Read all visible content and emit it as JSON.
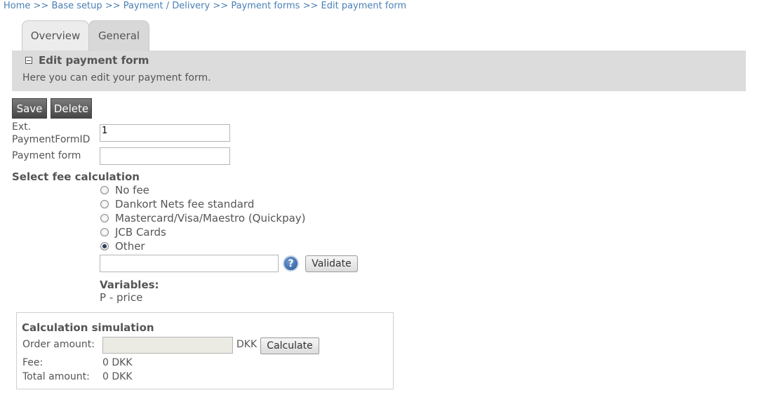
{
  "breadcrumb": {
    "items": [
      "Home",
      "Base setup",
      "Payment / Delivery",
      "Payment forms",
      "Edit payment form"
    ],
    "separator": ">>"
  },
  "tabs": [
    {
      "label": "Overview"
    },
    {
      "label": "General"
    }
  ],
  "panel": {
    "title": "Edit payment form",
    "description": "Here you can edit your payment form."
  },
  "actions": {
    "save_label": "Save",
    "delete_label": "Delete"
  },
  "form": {
    "ext_id_label_line1": "Ext.",
    "ext_id_label_line2": "PaymentFormID",
    "ext_id_value": "1",
    "payment_form_label": "Payment form",
    "payment_form_value": ""
  },
  "fee": {
    "section_title": "Select fee calculation",
    "options": [
      {
        "label": "No fee",
        "checked": false
      },
      {
        "label": "Dankort Nets fee standard",
        "checked": false
      },
      {
        "label": "Mastercard/Visa/Maestro (Quickpay)",
        "checked": false
      },
      {
        "label": "JCB Cards",
        "checked": false
      },
      {
        "label": "Other",
        "checked": true
      }
    ],
    "formula_value": "",
    "help_glyph": "?",
    "validate_label": "Validate",
    "variables_title": "Variables:",
    "variables_item": "P - price"
  },
  "simulation": {
    "title": "Calculation simulation",
    "order_amount_label": "Order amount:",
    "currency": "DKK",
    "calculate_label": "Calculate",
    "fee_label": "Fee:",
    "fee_value": "0 DKK",
    "total_label": "Total amount:",
    "total_value": "0 DKK"
  },
  "icons": {
    "collapse": "minus-square-icon",
    "help": "help-icon"
  }
}
